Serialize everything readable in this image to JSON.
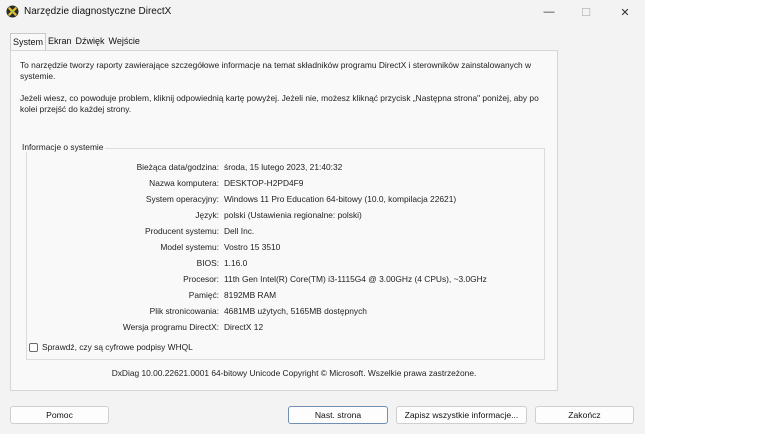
{
  "window": {
    "title": "Narzędzie diagnostyczne DirectX",
    "min_glyph": "—",
    "max_glyph": "☐",
    "close_glyph": "✕"
  },
  "tabs": [
    {
      "label": "System",
      "active": true
    },
    {
      "label": "Ekran"
    },
    {
      "label": "Dźwięk"
    },
    {
      "label": "Wejście"
    }
  ],
  "intro": {
    "p1": "To narzędzie tworzy raporty zawierające szczegółowe informacje na temat składników programu DirectX i sterowników zainstalowanych w systemie.",
    "p2": "Jeżeli wiesz, co powoduje problem, kliknij odpowiednią kartę powyżej. Jeżeli nie, możesz kliknąć przycisk „Następna strona\" poniżej, aby po kolei przejść do każdej strony."
  },
  "system_info": {
    "title": "Informacje o systemie",
    "rows": [
      {
        "label": "Bieżąca data/godzina:",
        "value": "środa, 15 lutego 2023, 21:40:32"
      },
      {
        "label": "Nazwa komputera:",
        "value": "DESKTOP-H2PD4F9"
      },
      {
        "label": "System operacyjny:",
        "value": "Windows 11 Pro Education 64-bitowy (10.0, kompilacja 22621)"
      },
      {
        "label": "Język:",
        "value": "polski (Ustawienia regionalne: polski)"
      },
      {
        "label": "Producent systemu:",
        "value": "Dell Inc."
      },
      {
        "label": "Model systemu:",
        "value": "Vostro 15 3510"
      },
      {
        "label": "BIOS:",
        "value": "1.16.0"
      },
      {
        "label": "Procesor:",
        "value": "11th Gen Intel(R) Core(TM) i3-1115G4 @ 3.00GHz (4 CPUs), ~3.0GHz"
      },
      {
        "label": "Pamięć:",
        "value": "8192MB RAM"
      },
      {
        "label": "Plik stronicowania:",
        "value": "4681MB użytych, 5165MB dostępnych"
      },
      {
        "label": "Wersja programu DirectX:",
        "value": "DirectX 12"
      }
    ],
    "whql_label": "Sprawdź, czy są cyfrowe podpisy WHQL",
    "whql_checked": false
  },
  "copyright": "DxDiag 10.00.22621.0001 64-bitowy Unicode  Copyright © Microsoft. Wszelkie prawa zastrzeżone.",
  "buttons": {
    "help": "Pomoc",
    "next": "Nast. strona",
    "save": "Zapisz wszystkie informacje...",
    "finish": "Zakończ"
  },
  "colors": {
    "window_bg": "#f3f3f3",
    "panel_bg": "#f9f9f9",
    "primary_border": "#6f8fb3"
  },
  "icons": {
    "app": "directx-x-icon",
    "minimize": "minimize-icon",
    "maximize": "maximize-icon",
    "close": "close-icon"
  }
}
